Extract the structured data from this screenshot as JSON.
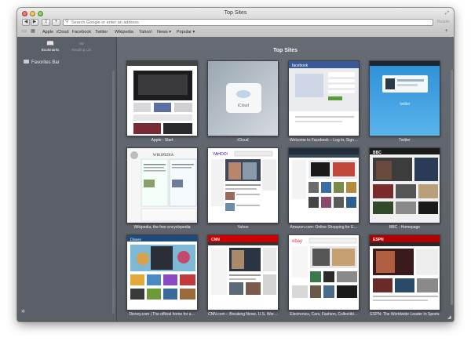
{
  "window": {
    "title": "Top Sites",
    "reader_label": "Reader"
  },
  "address": {
    "placeholder": "Search Google or enter an address"
  },
  "toolbar_icons": [
    "back-arrow-icon",
    "forward-arrow-icon",
    "sidebar-icon",
    "share-icon",
    "add-icon"
  ],
  "bookmarks_bar": [
    "Apple",
    "iCloud",
    "Facebook",
    "Twitter",
    "Wikipedia",
    "Yahoo!",
    "News ▾",
    "Popular ▾"
  ],
  "sidebar": {
    "tabs": [
      "Bookmarks",
      "Reading List"
    ],
    "favorites": "Favorites Bar",
    "footer_icon": "gear-icon"
  },
  "main": {
    "title": "Top Sites",
    "sites": [
      "Apple - Start",
      "iCloud",
      "Welcome to Facebook – Log In, Sign…",
      "Twitter",
      "Wikipedia, the free encyclopedia",
      "Yahoo",
      "Amazon.com: Online Shopping for E…",
      "BBC - Homepage",
      "Disney.com | The official home for a…",
      "CNN.com – Breaking News, U.S, Wor…",
      "Electronics, Cars, Fashion, Collectibl…",
      "ESPN: The Worldwide Leader In Sports"
    ],
    "thumb_text": {
      "icloud": "iCloud",
      "facebook": "facebook",
      "twitter": "twitter",
      "wikipedia": "WIKIPEDIA",
      "yahoo": "YAHOO!",
      "bbc": "BBC",
      "disney": "Disney",
      "cnn": "CNN",
      "ebay": "ebay",
      "espn": "ESPN"
    }
  },
  "colors": {
    "accent": "#3b5998",
    "sidebar": "#5b6068",
    "main_bg": "#62666d"
  }
}
